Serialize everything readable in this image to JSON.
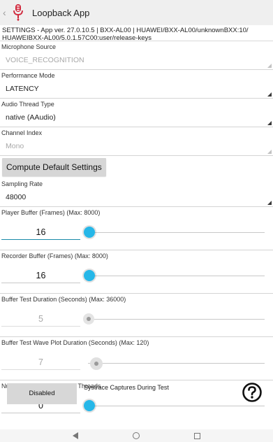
{
  "appbar": {
    "title": "Loopback App",
    "back_glyph": "‹",
    "logo_icon": "microphone-logo-icon",
    "logo_color": "#d0283c"
  },
  "info": {
    "settings_line": "SETTINGS - App ver. 27.0.10.5 | BXX-AL00 | HUAWEI/BXX-AL00/unknownBXX:10/ HUAWEIBXX-AL00/5.0.1.57C00:user/release-keys"
  },
  "microphone_source": {
    "label": "Microphone Source",
    "value": "VOICE_RECOGNITION"
  },
  "performance_mode": {
    "label": "Performance Mode",
    "value": "LATENCY"
  },
  "audio_thread_type": {
    "label": "Audio Thread Type",
    "value": "native (AAudio)"
  },
  "channel_index": {
    "label": "Channel Index",
    "value": "Mono"
  },
  "compute_button": {
    "label": "Compute Default Settings"
  },
  "sampling_rate": {
    "label": "Sampling Rate",
    "value": "48000"
  },
  "player_buffer": {
    "label": "Player Buffer (Frames) (Max: 8000)",
    "value": "16",
    "slider_fraction": 0.0
  },
  "recorder_buffer": {
    "label": "Recorder Buffer (Frames) (Max: 8000)",
    "value": "16",
    "slider_fraction": 0.0
  },
  "buffer_test_duration": {
    "label": "Buffer Test Duration (Seconds) (Max: 36000)",
    "value": "5",
    "slider_fraction": 0.0
  },
  "wave_plot_duration": {
    "label": "Buffer Test Wave Plot Duration (Seconds) (Max: 120)",
    "value": "7",
    "slider_fraction": 0.05
  },
  "load_threads": {
    "label": "Number of Simulated Load Threads",
    "value": "0",
    "slider_fraction": 0.0
  },
  "systrace": {
    "button_label": "Disabled",
    "label": "Systrace Captures During Test"
  },
  "colors": {
    "accent": "#26b7e8",
    "appbar_bg": "#efefef"
  },
  "navbar": {
    "back_icon": "nav-back-icon",
    "home_icon": "nav-home-icon",
    "recents_icon": "nav-recents-icon"
  }
}
